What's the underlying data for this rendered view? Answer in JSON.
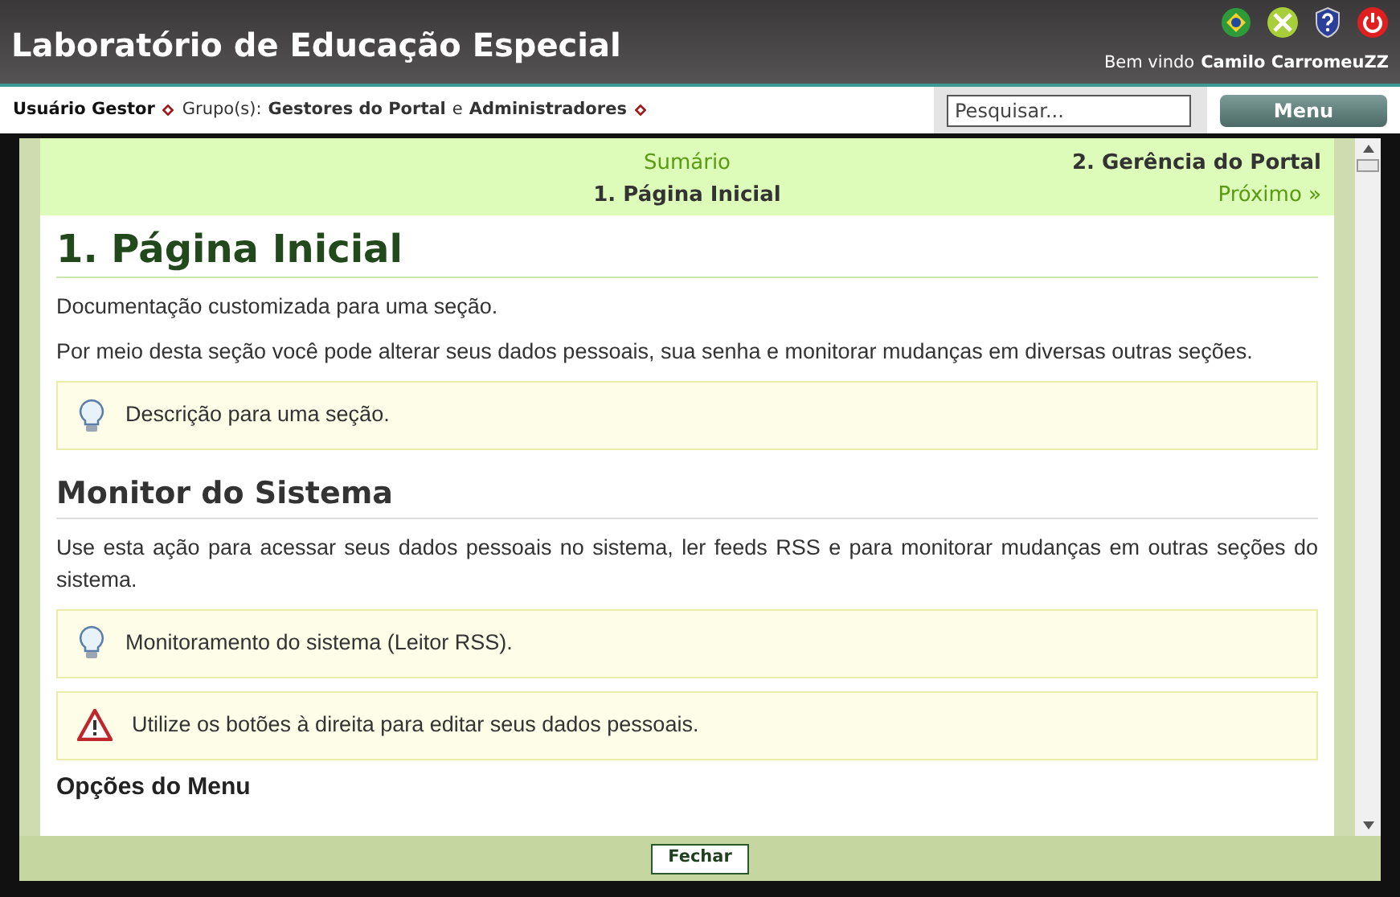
{
  "header": {
    "title": "Laboratório de Educação Especial",
    "welcome": "Bem vindo",
    "user": "Camilo CarromeuZZ"
  },
  "userbar": {
    "role": "Usuário Gestor",
    "groups_label": "Grupo(s):",
    "groups": [
      {
        "name": "Gestores do Portal"
      },
      {
        "name": "Administradores"
      }
    ],
    "joiner": "e",
    "search": {
      "placeholder": "Pesquisar..."
    },
    "menu_button": "Menu"
  },
  "nav": {
    "summary": "Sumário",
    "current": "1. Página Inicial",
    "next_title": "2. Gerência do Portal",
    "next_link": "Próximo »"
  },
  "content": [
    {
      "kind": "h1",
      "text": "1. Página Inicial"
    },
    {
      "kind": "p",
      "text": "Documentação customizada para uma seção."
    },
    {
      "kind": "p",
      "text": "Por meio desta seção você pode alterar seus dados pessoais, sua senha e monitorar mudanças em diversas outras seções."
    },
    {
      "kind": "tip",
      "text": "Descrição para uma seção."
    },
    {
      "kind": "h2",
      "text": "Monitor do Sistema"
    },
    {
      "kind": "p",
      "text": "Use esta ação para acessar seus dados pessoais no sistema, ler feeds RSS e para monitorar mudanças em outras seções do sistema."
    },
    {
      "kind": "tip",
      "text": "Monitoramento do sistema (Leitor RSS)."
    },
    {
      "kind": "warning",
      "text": "Utilize os botões à direita para editar seus dados pessoais."
    },
    {
      "kind": "h3",
      "text": "Opções do Menu"
    }
  ],
  "close_button": "Fechar"
}
